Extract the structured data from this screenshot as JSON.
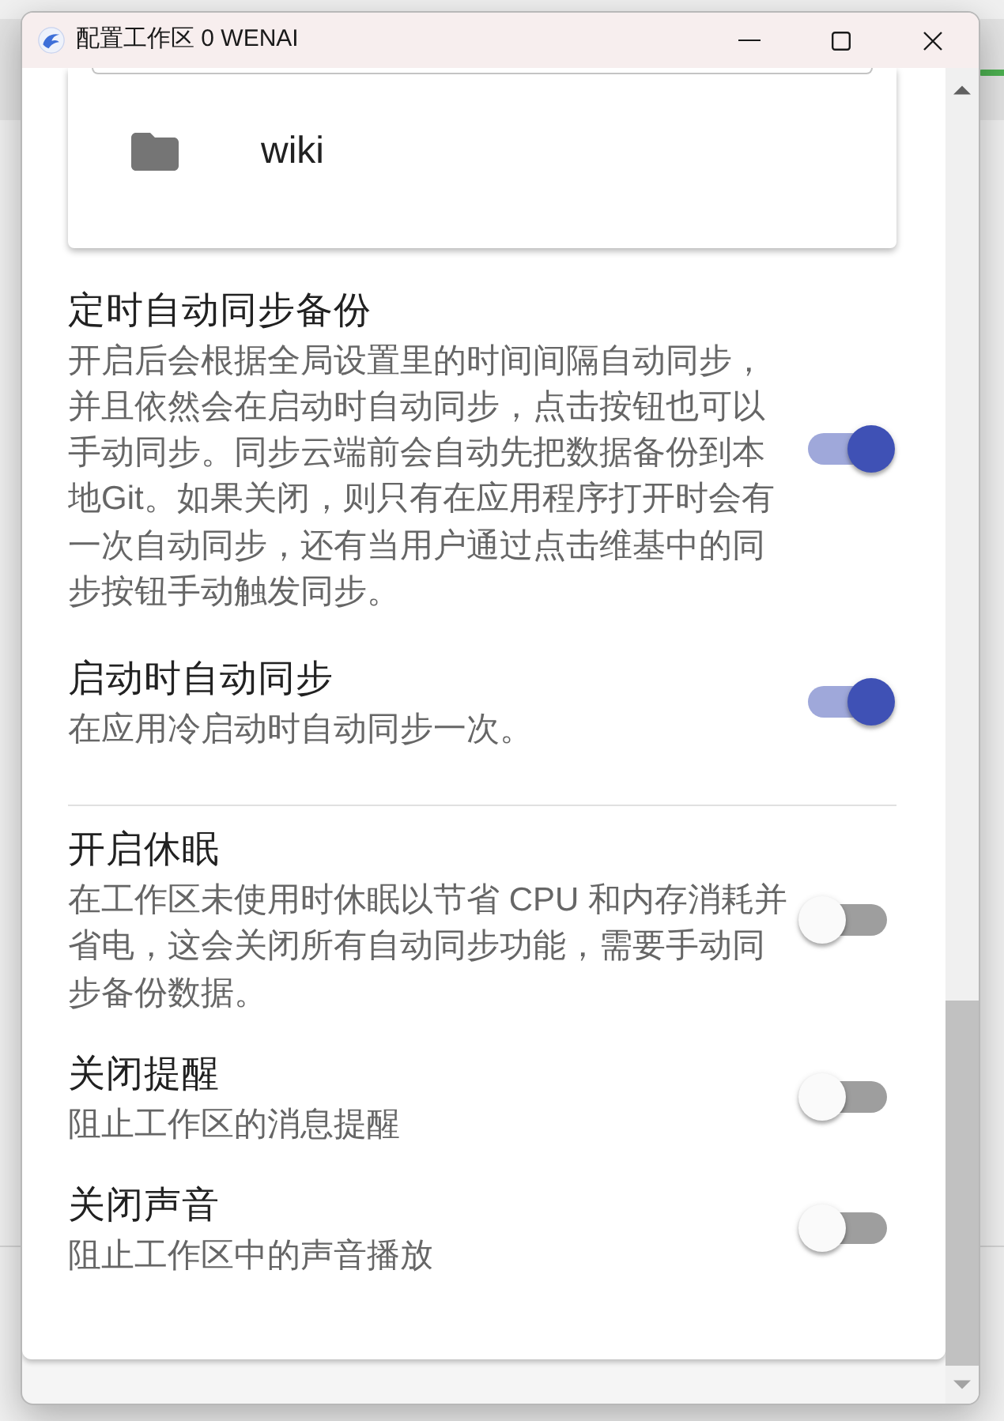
{
  "window": {
    "title": "配置工作区 0 WENAI"
  },
  "workspace_folder": {
    "name": "wiki"
  },
  "sections": [
    {
      "items": [
        {
          "title": "定时自动同步备份",
          "description": "开启后会根据全局设置里的时间间隔自动同步，并且依然会在启动时自动同步，点击按钮也可以手动同步。同步云端前会自动先把数据备份到本地Git。如果关闭，则只有在应用程序打开时会有一次自动同步，还有当用户通过点击维基中的同步按钮手动触发同步。",
          "on": true
        },
        {
          "title": "启动时自动同步",
          "description": "在应用冷启动时自动同步一次。",
          "on": true
        }
      ]
    },
    {
      "items": [
        {
          "title": "开启休眠",
          "description": "在工作区未使用时休眠以节省 CPU 和内存消耗并省电，这会关闭所有自动同步功能，需要手动同步备份数据。",
          "on": false
        },
        {
          "title": "关闭提醒",
          "description": "阻止工作区的消息提醒",
          "on": false
        },
        {
          "title": "关闭声音",
          "description": "阻止工作区中的声音播放",
          "on": false
        }
      ]
    }
  ]
}
